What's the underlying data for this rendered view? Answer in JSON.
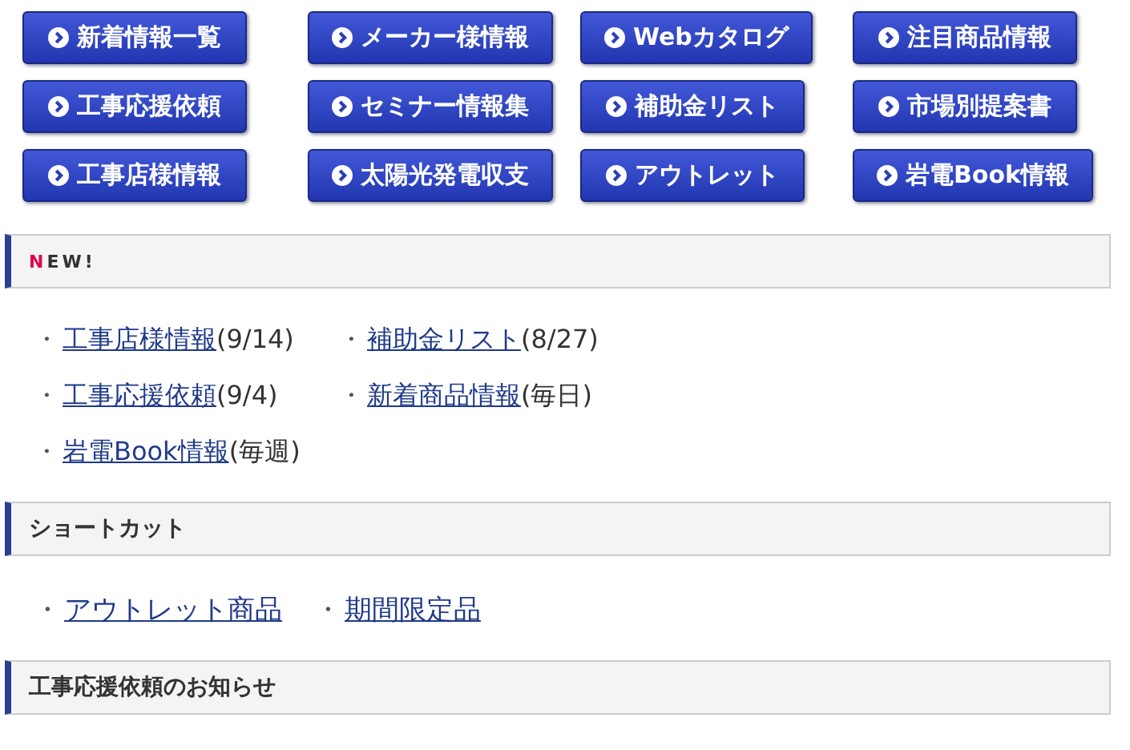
{
  "nav_buttons": [
    {
      "label": "新着情報一覧"
    },
    {
      "label": "メーカー様情報"
    },
    {
      "label": "Webカタログ"
    },
    {
      "label": "注目商品情報"
    },
    {
      "label": "工事応援依頼"
    },
    {
      "label": "セミナー情報集"
    },
    {
      "label": "補助金リスト"
    },
    {
      "label": "市場別提案書"
    },
    {
      "label": "工事店様情報"
    },
    {
      "label": "太陽光発電収支"
    },
    {
      "label": "アウトレット"
    },
    {
      "label": "岩電Book情報"
    }
  ],
  "sections": [
    {
      "heading": "NEW!",
      "kind": "new",
      "links": [
        {
          "bullet": "・",
          "link": "工事店様情報",
          "note": "(9/14)"
        },
        {
          "bullet": "・",
          "link": "補助金リスト",
          "note": "(8/27)"
        },
        {
          "bullet": "・",
          "link": "工事応援依頼",
          "note": "(9/4)"
        },
        {
          "bullet": "・",
          "link": "新着商品情報",
          "note": "(毎日)"
        },
        {
          "bullet": "・",
          "link": "岩電Book情報",
          "note": "(毎週)"
        }
      ]
    },
    {
      "heading": "ショートカット",
      "kind": "plain",
      "links": [
        {
          "bullet": "・",
          "link": "アウトレット商品"
        },
        {
          "bullet": "・",
          "link": "期間限定品"
        }
      ]
    },
    {
      "heading": "工事応援依頼のお知らせ",
      "kind": "plain"
    }
  ]
}
